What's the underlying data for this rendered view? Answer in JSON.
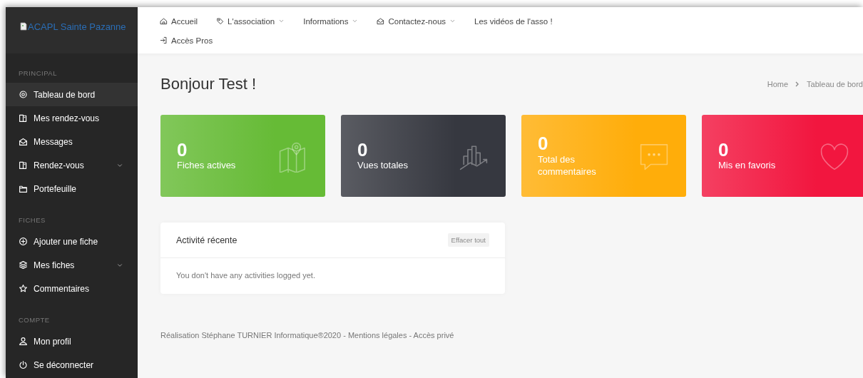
{
  "logo": {
    "alt_text": "ACAPL Sainte Pazanne"
  },
  "top_nav": [
    {
      "label": "Accueil",
      "has_dropdown": false
    },
    {
      "label": "L'association",
      "has_dropdown": true
    },
    {
      "label": "Informations",
      "has_dropdown": true
    },
    {
      "label": "Contactez-nous",
      "has_dropdown": true
    },
    {
      "label": "Les vidéos de l'asso !",
      "has_dropdown": false
    },
    {
      "label": "Accès Pros",
      "has_dropdown": false
    }
  ],
  "sidebar": {
    "sections": [
      {
        "title": "PRINCIPAL",
        "items": [
          {
            "label": "Tableau de bord",
            "selected": true,
            "has_dropdown": false
          },
          {
            "label": "Mes rendez-vous",
            "selected": false,
            "has_dropdown": false
          },
          {
            "label": "Messages",
            "selected": false,
            "has_dropdown": false
          },
          {
            "label": "Rendez-vous",
            "selected": false,
            "has_dropdown": true
          },
          {
            "label": "Portefeuille",
            "selected": false,
            "has_dropdown": false
          }
        ]
      },
      {
        "title": "FICHES",
        "items": [
          {
            "label": "Ajouter une fiche",
            "selected": false,
            "has_dropdown": false
          },
          {
            "label": "Mes fiches",
            "selected": false,
            "has_dropdown": true
          },
          {
            "label": "Commentaires",
            "selected": false,
            "has_dropdown": false
          }
        ]
      },
      {
        "title": "COMPTE",
        "items": [
          {
            "label": "Mon profil",
            "selected": false,
            "has_dropdown": false
          },
          {
            "label": "Se déconnecter",
            "selected": false,
            "has_dropdown": false
          }
        ]
      }
    ]
  },
  "heading": "Bonjour Test !",
  "breadcrumb": [
    "Home",
    "Tableau de bord"
  ],
  "stat_cards": [
    {
      "value": "0",
      "label": "Fiches actives",
      "color": "#66bb36"
    },
    {
      "value": "0",
      "label": "Vues totales",
      "color": "#363840"
    },
    {
      "value": "0",
      "label": "Total des commentaires",
      "color": "#ffad0a"
    },
    {
      "value": "0",
      "label": "Mis en favoris",
      "color": "#f2163f"
    }
  ],
  "activity": {
    "title": "Activité récente",
    "clear_button": "Effacer tout",
    "empty_message": "You don't have any activities logged yet."
  },
  "footer": {
    "text": "Réalisation Stéphane TURNIER Informatique®2020",
    "links": [
      "Mentions légales",
      "Accès privé"
    ],
    "separator": "-"
  }
}
